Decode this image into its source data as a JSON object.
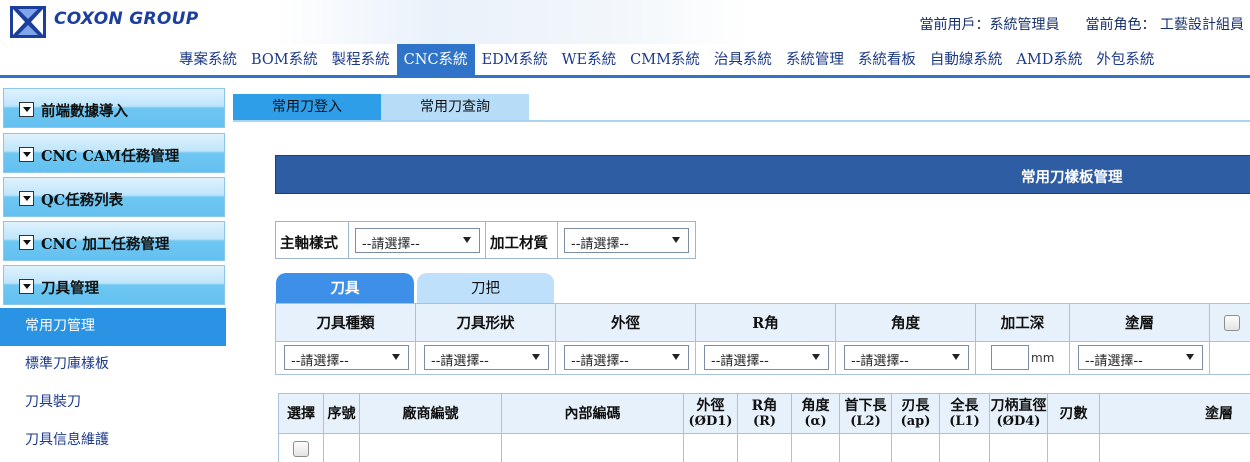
{
  "header": {
    "company": "COXON GROUP",
    "current_user": "當前用戶：系統管理員",
    "current_role": "當前角色： 工藝設計組員"
  },
  "nav": {
    "items": [
      "專案系統",
      "BOM系統",
      "製程系統",
      "CNC系統",
      "EDM系統",
      "WE系統",
      "CMM系統",
      "治具系統",
      "系統管理",
      "系統看板",
      "自動線系統",
      "AMD系統",
      "外包系統"
    ],
    "active": "CNC系統"
  },
  "sidebar": {
    "groups": [
      "前端數據導入",
      "CNC CAM任務管理",
      "QC任務列表",
      "CNC 加工任務管理",
      "刀具管理"
    ],
    "items": [
      "常用刀管理",
      "標準刀庫樣板",
      "刀具裝刀",
      "刀具信息維護"
    ],
    "active_item": "常用刀管理"
  },
  "main": {
    "tabs": [
      "常用刀登入",
      "常用刀查詢"
    ],
    "title": "常用刀樣板管理",
    "filter": {
      "spindle_label": "主軸樣式",
      "spindle_value": "--請選擇--",
      "material_label": "加工材質",
      "material_value": "--請選擇--"
    },
    "sub_tabs": [
      "刀具",
      "刀把"
    ],
    "tool_table": {
      "headers": [
        "刀具種類",
        "刀具形狀",
        "外徑",
        "R角",
        "角度",
        "加工深",
        "塗層"
      ],
      "select_value": "--請選擇--",
      "unit": "mm"
    },
    "grid": {
      "headers": [
        {
          "line1": "選擇",
          "line2": ""
        },
        {
          "line1": "序號",
          "line2": ""
        },
        {
          "line1": "廠商編號",
          "line2": ""
        },
        {
          "line1": "內部編碼",
          "line2": ""
        },
        {
          "line1": "外徑",
          "line2": "(ØD1)"
        },
        {
          "line1": "R角",
          "line2": "(R)"
        },
        {
          "line1": "角度",
          "line2": "(α)"
        },
        {
          "line1": "首下長",
          "line2": "(L2)"
        },
        {
          "line1": "刃長",
          "line2": "(ap)"
        },
        {
          "line1": "全長",
          "line2": "(L1)"
        },
        {
          "line1": "刀柄直徑",
          "line2": "(ØD4)"
        },
        {
          "line1": "刃數",
          "line2": ""
        },
        {
          "line1": "塗層",
          "line2": ""
        }
      ]
    }
  },
  "colors": {
    "brand": "#1d3f9c",
    "nav_active": "#2f74c8",
    "title_bar": "#2f5da3",
    "sidebar_active": "#2a93e3"
  }
}
